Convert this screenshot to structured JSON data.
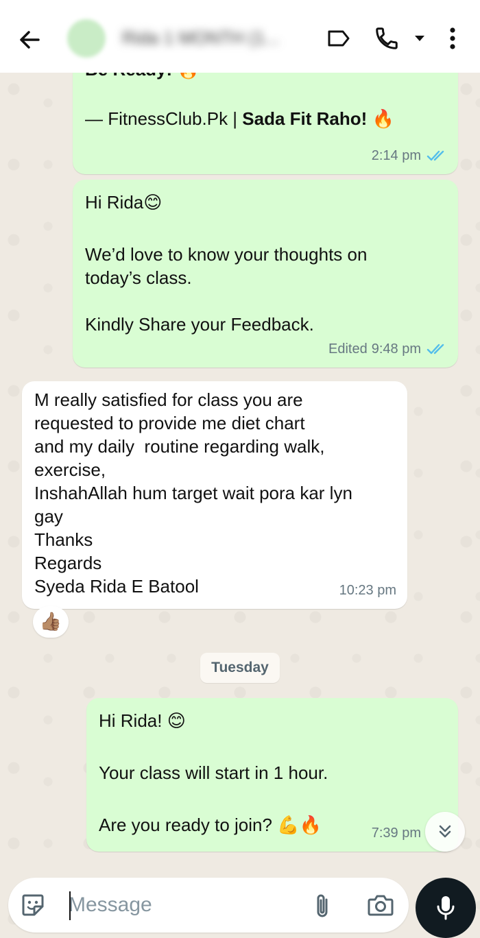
{
  "header": {
    "contact_name": "Rida 1 MONTH (1...",
    "back_icon": "arrow-left-icon",
    "label_icon": "label-icon",
    "call_icon": "phone-icon",
    "menu_icon": "more-vertical-icon"
  },
  "messages": [
    {
      "direction": "out",
      "lines": [
        "Be Ready! 🔥",
        "",
        "— FitnessClub.Pk | "
      ],
      "bold_suffix": "Sada Fit Raho! 🔥",
      "time": "2:14 pm",
      "status": "read"
    },
    {
      "direction": "out",
      "lines": [
        "Hi Rida😊",
        "",
        "We’d love to know your thoughts on",
        "today’s class.",
        "",
        "Kindly Share your Feedback."
      ],
      "edited_label": "Edited",
      "time": "9:48 pm",
      "status": "read"
    },
    {
      "direction": "in",
      "lines": [
        "M really satisfied for class you are",
        "requested to provide me diet chart",
        "and my daily  routine regarding walk,",
        "exercise,",
        "InshahAllah hum target wait pora kar lyn",
        "gay",
        "Thanks",
        "Regards",
        "Syeda Rida E Batool"
      ],
      "time": "10:23 pm",
      "reaction": "👍🏽"
    },
    {
      "direction": "out",
      "lines": [
        "Hi Rida! 😊",
        "",
        "Your class will start in 1 hour.",
        "",
        "Are you ready to join? 💪🔥"
      ],
      "time": "7:39 pm"
    }
  ],
  "date_separator": "Tuesday",
  "composer": {
    "placeholder": "Message",
    "emoji_icon": "sticker-icon",
    "attach_icon": "paperclip-icon",
    "camera_icon": "camera-icon",
    "mic_icon": "microphone-icon"
  },
  "colors": {
    "outgoing_bubble": "#d9fdd3",
    "incoming_bubble": "#ffffff",
    "read_ticks": "#53bdeb",
    "chat_background": "#efeae2"
  }
}
